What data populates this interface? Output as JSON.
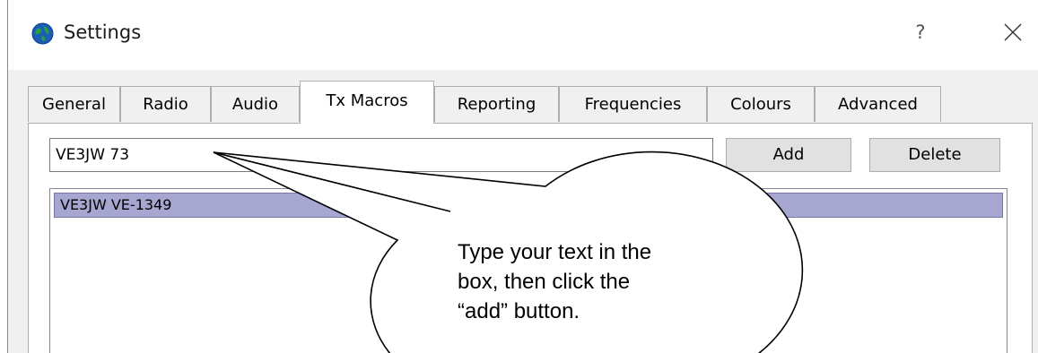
{
  "window": {
    "title": "Settings",
    "help_label": "?",
    "icons": {
      "app": "globe-icon",
      "close": "close-icon"
    }
  },
  "tabs": [
    {
      "label": "General",
      "active": false
    },
    {
      "label": "Radio",
      "active": false
    },
    {
      "label": "Audio",
      "active": false
    },
    {
      "label": "Tx Macros",
      "active": true
    },
    {
      "label": "Reporting",
      "active": false
    },
    {
      "label": "Frequencies",
      "active": false
    },
    {
      "label": "Colours",
      "active": false
    },
    {
      "label": "Advanced",
      "active": false
    }
  ],
  "macro": {
    "input_value": "VE3JW 73",
    "add_label": "Add",
    "delete_label": "Delete",
    "items": [
      "VE3JW VE-1349"
    ]
  },
  "callout": {
    "lines": [
      "Type your text in the",
      "box, then click the",
      "“add” button."
    ]
  },
  "colors": {
    "selection": "#a6a6d0",
    "panel": "#ffffff",
    "chrome": "#f0f0f0"
  }
}
